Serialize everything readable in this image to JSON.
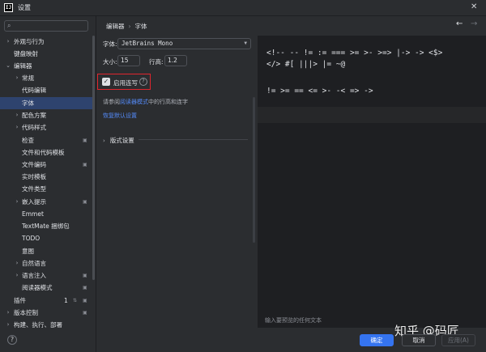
{
  "window": {
    "title": "设置",
    "app_icon_text": "IJ",
    "close_glyph": "✕"
  },
  "search": {
    "icon_glyph": "⌕",
    "placeholder": ""
  },
  "sidebar": {
    "items": [
      {
        "label": "外观与行为",
        "expandable": true
      },
      {
        "label": "键盘映射",
        "expandable": false
      },
      {
        "label": "编辑器",
        "expandable": true,
        "expanded": true
      },
      {
        "label": "常规",
        "expandable": true
      },
      {
        "label": "代码编辑",
        "expandable": false
      },
      {
        "label": "字体",
        "expandable": false,
        "selected": true
      },
      {
        "label": "配色方案",
        "expandable": true
      },
      {
        "label": "代码样式",
        "expandable": true
      },
      {
        "label": "检查",
        "expandable": false,
        "side_icon": "project-icon"
      },
      {
        "label": "文件和代码模板",
        "expandable": false
      },
      {
        "label": "文件编码",
        "expandable": false,
        "side_icon": "project-icon"
      },
      {
        "label": "实时模板",
        "expandable": false
      },
      {
        "label": "文件类型",
        "expandable": false
      },
      {
        "label": "嵌入提示",
        "expandable": true,
        "side_icon": "project-icon"
      },
      {
        "label": "Emmet",
        "expandable": false
      },
      {
        "label": "TextMate 捆绑包",
        "expandable": false
      },
      {
        "label": "TODO",
        "expandable": false
      },
      {
        "label": "意图",
        "expandable": false
      },
      {
        "label": "自然语言",
        "expandable": true
      },
      {
        "label": "语言注入",
        "expandable": true,
        "side_icon": "project-icon"
      },
      {
        "label": "阅读器模式",
        "expandable": false,
        "side_icon": "project-icon"
      },
      {
        "label": "插件",
        "expandable": false,
        "count": "1"
      },
      {
        "label": "版本控制",
        "expandable": true,
        "side_icon": "project-icon"
      },
      {
        "label": "构建、执行、部署",
        "expandable": true
      }
    ]
  },
  "breadcrumb": {
    "parent": "编辑器",
    "separator": "›",
    "current": "字体"
  },
  "nav": {
    "back": "←",
    "forward": "→"
  },
  "font": {
    "font_label": "字体:",
    "font_value": "JetBrains Mono",
    "size_label": "大小:",
    "size_value": "15",
    "line_height_label": "行高:",
    "line_height_value": "1.2",
    "ligatures_label": "启用连写",
    "ligatures_checked": true,
    "reader_note_prefix": "请参阅",
    "reader_note_link": "阅读器模式",
    "reader_note_suffix": "中的行高和连字",
    "restore_defaults": "恢复默认设置",
    "layout_section": "版式设置"
  },
  "preview": {
    "lines": [
      "<!-- -- != := === >= >- >=> |-> -> <$>",
      "</> #[ |||> |= ~@",
      "",
      "!= >= == <= >- -< => ->"
    ],
    "hint": "输入要预览的任何文本"
  },
  "buttons": {
    "ok": "确定",
    "cancel": "取消",
    "apply": "应用(A)"
  },
  "watermark": "知乎 @码匠",
  "colors": {
    "accent": "#3574f0",
    "link": "#548af7",
    "highlight_border": "#e0252d",
    "selected_row": "#2e436e"
  }
}
